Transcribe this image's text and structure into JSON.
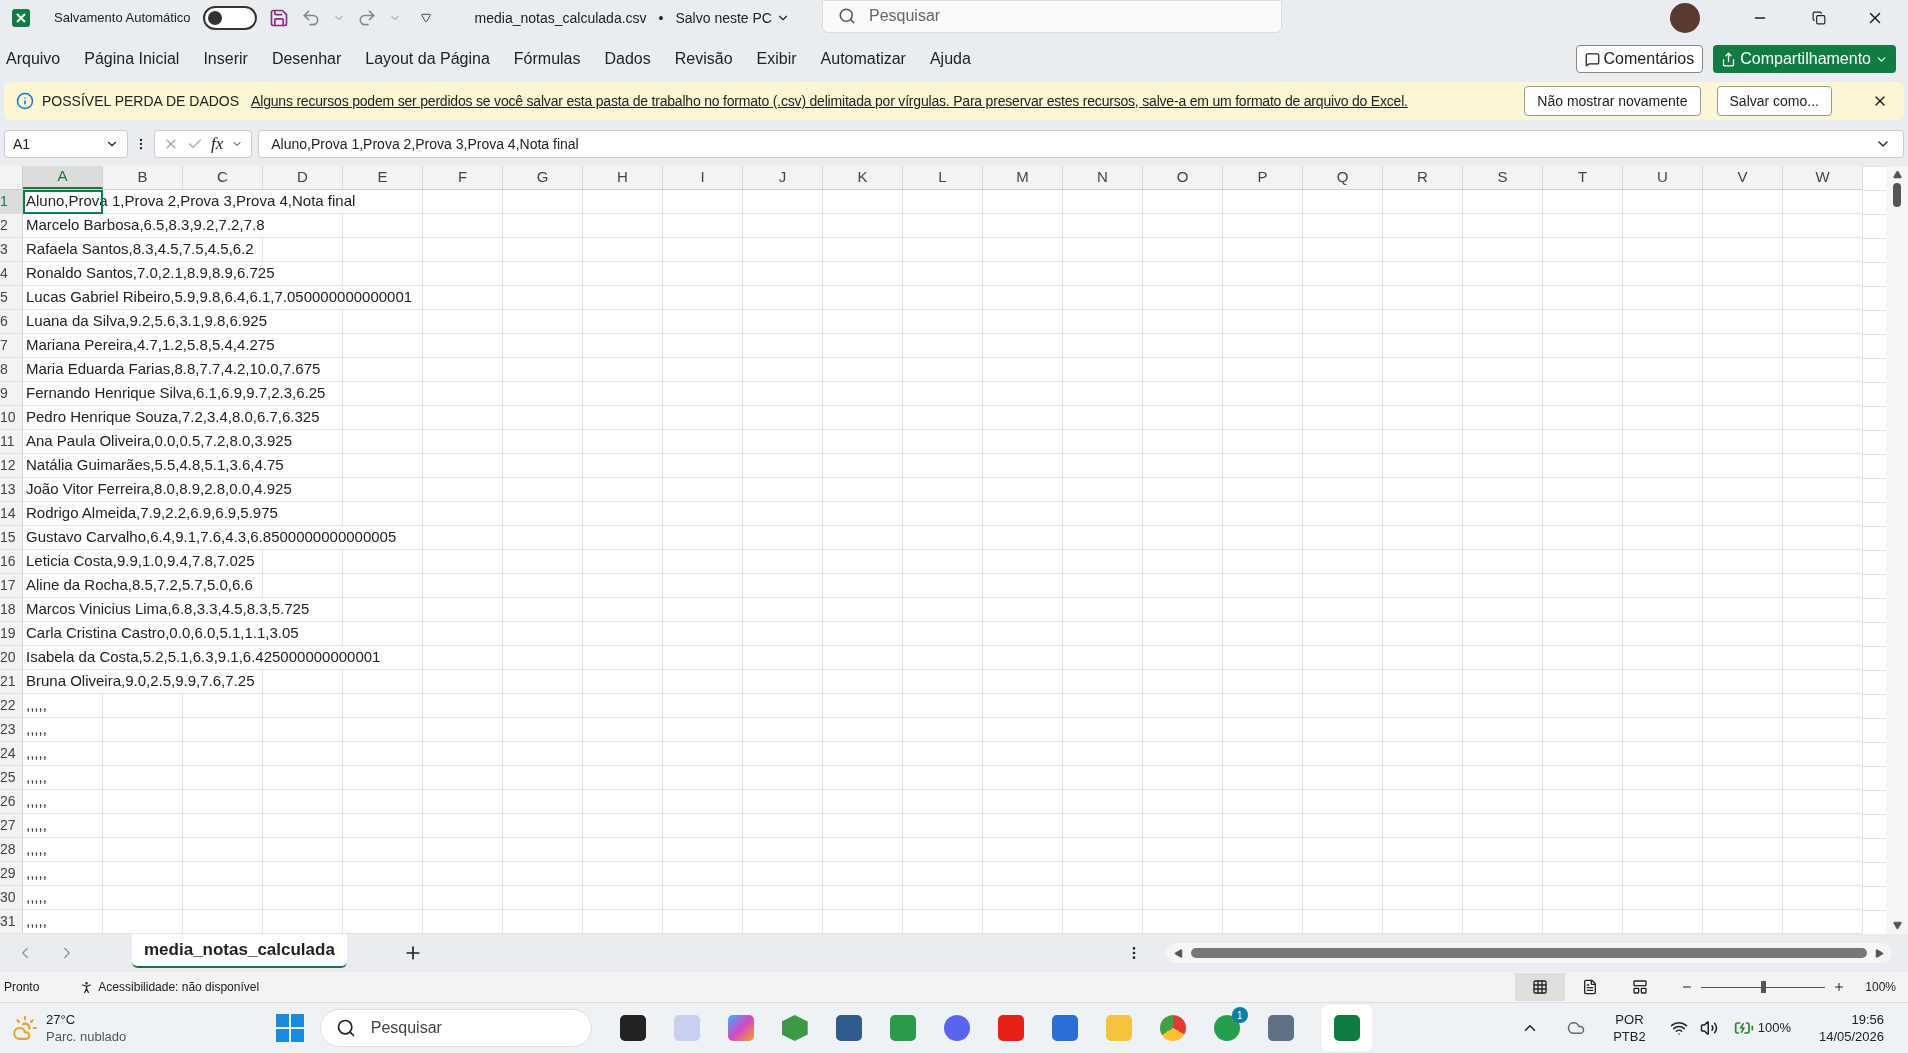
{
  "title_bar": {
    "autosave_label": "Salvamento Automático",
    "autosave_on": false,
    "filename": "media_notas_calculada.csv",
    "separator": "•",
    "saved_status": "Salvo neste PC",
    "search_placeholder": "Pesquisar"
  },
  "menu": {
    "items": [
      "Arquivo",
      "Página Inicial",
      "Inserir",
      "Desenhar",
      "Layout da Página",
      "Fórmulas",
      "Dados",
      "Revisão",
      "Exibir",
      "Automatizar",
      "Ajuda"
    ],
    "comments_button": "Comentários",
    "share_button": "Compartilhamento"
  },
  "banner": {
    "title": "POSSÍVEL PERDA DE DADOS",
    "message": "Alguns recursos podem ser perdidos se você salvar esta pasta de trabalho no formato (.csv) delimitada por vírgulas. Para preservar estes recursos, salve-a em um formato de arquivo do Excel.",
    "buttons": [
      "Não mostrar novamente",
      "Salvar como..."
    ]
  },
  "formula_bar": {
    "name_box": "A1",
    "fx": "fx",
    "formula": "Aluno,Prova 1,Prova 2,Prova 3,Prova 4,Nota final"
  },
  "columns": [
    {
      "label": "A",
      "selected": true
    },
    {
      "label": "B",
      "selected": false
    },
    {
      "label": "C",
      "selected": false
    },
    {
      "label": "D",
      "selected": false
    },
    {
      "label": "E",
      "selected": false
    },
    {
      "label": "F",
      "selected": false
    },
    {
      "label": "G",
      "selected": false
    },
    {
      "label": "H",
      "selected": false
    },
    {
      "label": "I",
      "selected": false
    },
    {
      "label": "J",
      "selected": false
    },
    {
      "label": "K",
      "selected": false
    },
    {
      "label": "L",
      "selected": false
    },
    {
      "label": "M",
      "selected": false
    },
    {
      "label": "N",
      "selected": false
    },
    {
      "label": "O",
      "selected": false
    },
    {
      "label": "P",
      "selected": false
    },
    {
      "label": "Q",
      "selected": false
    },
    {
      "label": "R",
      "selected": false
    },
    {
      "label": "S",
      "selected": false
    },
    {
      "label": "T",
      "selected": false
    },
    {
      "label": "U",
      "selected": false
    },
    {
      "label": "V",
      "selected": false
    },
    {
      "label": "W",
      "selected": false
    }
  ],
  "rows": [
    {
      "number": "1",
      "text": "Aluno,Prova 1,Prova 2,Prova 3,Prova 4,Nota final",
      "selected": true
    },
    {
      "number": "2",
      "text": "Marcelo Barbosa,6.5,8.3,9.2,7.2,7.8",
      "selected": false
    },
    {
      "number": "3",
      "text": "Rafaela Santos,8.3,4.5,7.5,4.5,6.2",
      "selected": false
    },
    {
      "number": "4",
      "text": "Ronaldo Santos,7.0,2.1,8.9,8.9,6.725",
      "selected": false
    },
    {
      "number": "5",
      "text": "Lucas Gabriel Ribeiro,5.9,9.8,6.4,6.1,7.050000000000001",
      "selected": false
    },
    {
      "number": "6",
      "text": "Luana da Silva,9.2,5.6,3.1,9.8,6.925",
      "selected": false
    },
    {
      "number": "7",
      "text": "Mariana Pereira,4.7,1.2,5.8,5.4,4.275",
      "selected": false
    },
    {
      "number": "8",
      "text": "Maria Eduarda Farias,8.8,7.7,4.2,10.0,7.675",
      "selected": false
    },
    {
      "number": "9",
      "text": "Fernando Henrique Silva,6.1,6.9,9.7,2.3,6.25",
      "selected": false
    },
    {
      "number": "10",
      "text": "Pedro Henrique Souza,7.2,3.4,8.0,6.7,6.325",
      "selected": false
    },
    {
      "number": "11",
      "text": "Ana Paula Oliveira,0.0,0.5,7.2,8.0,3.925",
      "selected": false
    },
    {
      "number": "12",
      "text": "Natália Guimarães,5.5,4.8,5.1,3.6,4.75",
      "selected": false
    },
    {
      "number": "13",
      "text": "João Vitor Ferreira,8.0,8.9,2.8,0.0,4.925",
      "selected": false
    },
    {
      "number": "14",
      "text": "Rodrigo Almeida,7.9,2.2,6.9,6.9,5.975",
      "selected": false
    },
    {
      "number": "15",
      "text": "Gustavo Carvalho,6.4,9.1,7.6,4.3,6.8500000000000005",
      "selected": false
    },
    {
      "number": "16",
      "text": "Leticia Costa,9.9,1.0,9.4,7.8,7.025",
      "selected": false
    },
    {
      "number": "17",
      "text": "Aline da Rocha,8.5,7.2,5.7,5.0,6.6",
      "selected": false
    },
    {
      "number": "18",
      "text": "Marcos Vinicius Lima,6.8,3.3,4.5,8.3,5.725",
      "selected": false
    },
    {
      "number": "19",
      "text": "Carla Cristina Castro,0.0,6.0,5.1,1.1,3.05",
      "selected": false
    },
    {
      "number": "20",
      "text": "Isabela da Costa,5.2,5.1,6.3,9.1,6.425000000000001",
      "selected": false
    },
    {
      "number": "21",
      "text": "Bruna Oliveira,9.0,2.5,9.9,7.6,7.25",
      "selected": false
    },
    {
      "number": "22",
      "text": ",,,,,",
      "selected": false
    },
    {
      "number": "23",
      "text": ",,,,,",
      "selected": false
    },
    {
      "number": "24",
      "text": ",,,,,",
      "selected": false
    },
    {
      "number": "25",
      "text": ",,,,,",
      "selected": false
    },
    {
      "number": "26",
      "text": ",,,,,",
      "selected": false
    },
    {
      "number": "27",
      "text": ",,,,,",
      "selected": false
    },
    {
      "number": "28",
      "text": ",,,,,",
      "selected": false
    },
    {
      "number": "29",
      "text": ",,,,,",
      "selected": false
    },
    {
      "number": "30",
      "text": ",,,,,",
      "selected": false
    },
    {
      "number": "31",
      "text": ",,,,,",
      "selected": false
    }
  ],
  "sheet_tabs": [
    {
      "label": "media_notas_calculada",
      "selected": true
    }
  ],
  "status_bar": {
    "ready": "Pronto",
    "accessibility": "Acessibilidade: não disponível",
    "views": [
      {
        "kind": "normal",
        "selected": true
      },
      {
        "kind": "page_layout",
        "selected": false
      },
      {
        "kind": "page_break",
        "selected": false
      }
    ],
    "zoom": {
      "level": 0.5,
      "reading": "100%"
    }
  },
  "taskbar": {
    "temperature": "27°C",
    "weather": "Parc. nublado",
    "search_placeholder": "Pesquisar",
    "notification_badge": "1",
    "language": "POR",
    "layout": "PTB2",
    "battery": "100%",
    "time": "19:56",
    "date": "14/05/2026"
  }
}
